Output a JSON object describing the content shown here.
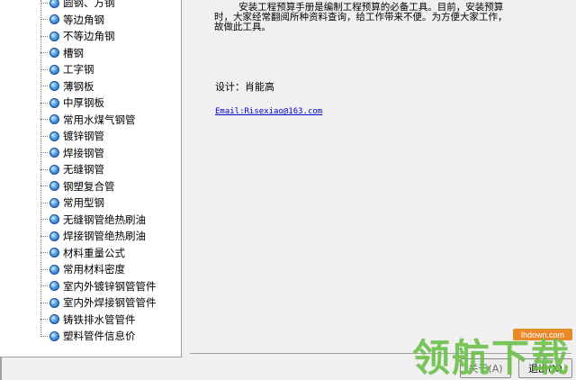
{
  "tree": {
    "items": [
      {
        "label": "圆钢、方钢"
      },
      {
        "label": "等边角钢"
      },
      {
        "label": "不等边角钢"
      },
      {
        "label": "槽钢"
      },
      {
        "label": "工字钢"
      },
      {
        "label": "薄钢板"
      },
      {
        "label": "中厚钢板"
      },
      {
        "label": "常用水煤气钢管"
      },
      {
        "label": "镀锌钢管"
      },
      {
        "label": "焊接钢管"
      },
      {
        "label": "无缝钢管"
      },
      {
        "label": "钢塑复合管"
      },
      {
        "label": "常用型钢"
      },
      {
        "label": "无缝钢管绝热刷油"
      },
      {
        "label": "焊接钢管绝热刷油"
      },
      {
        "label": "材料重量公式"
      },
      {
        "label": "常用材料密度"
      },
      {
        "label": "室内外镀锌钢管管件"
      },
      {
        "label": "室内外焊接钢管管件"
      },
      {
        "label": "铸铁排水管管件"
      },
      {
        "label": "塑料管件信息价"
      }
    ]
  },
  "content": {
    "description": "安装工程预算手册是编制工程预算的必备工具。目前，安装预算时，大家经常翻阅所种资料查询，给工作带来不便。为方便大家工作，故做此工具。",
    "designer": "设计：肖能高",
    "email": "Email:Risexiao@163.com"
  },
  "buttons": {
    "about": "关于(A)",
    "exit": "退出(X)"
  },
  "watermark": {
    "text": "领航下载",
    "site": "lhdown.com",
    "color": "#6cc04a"
  }
}
